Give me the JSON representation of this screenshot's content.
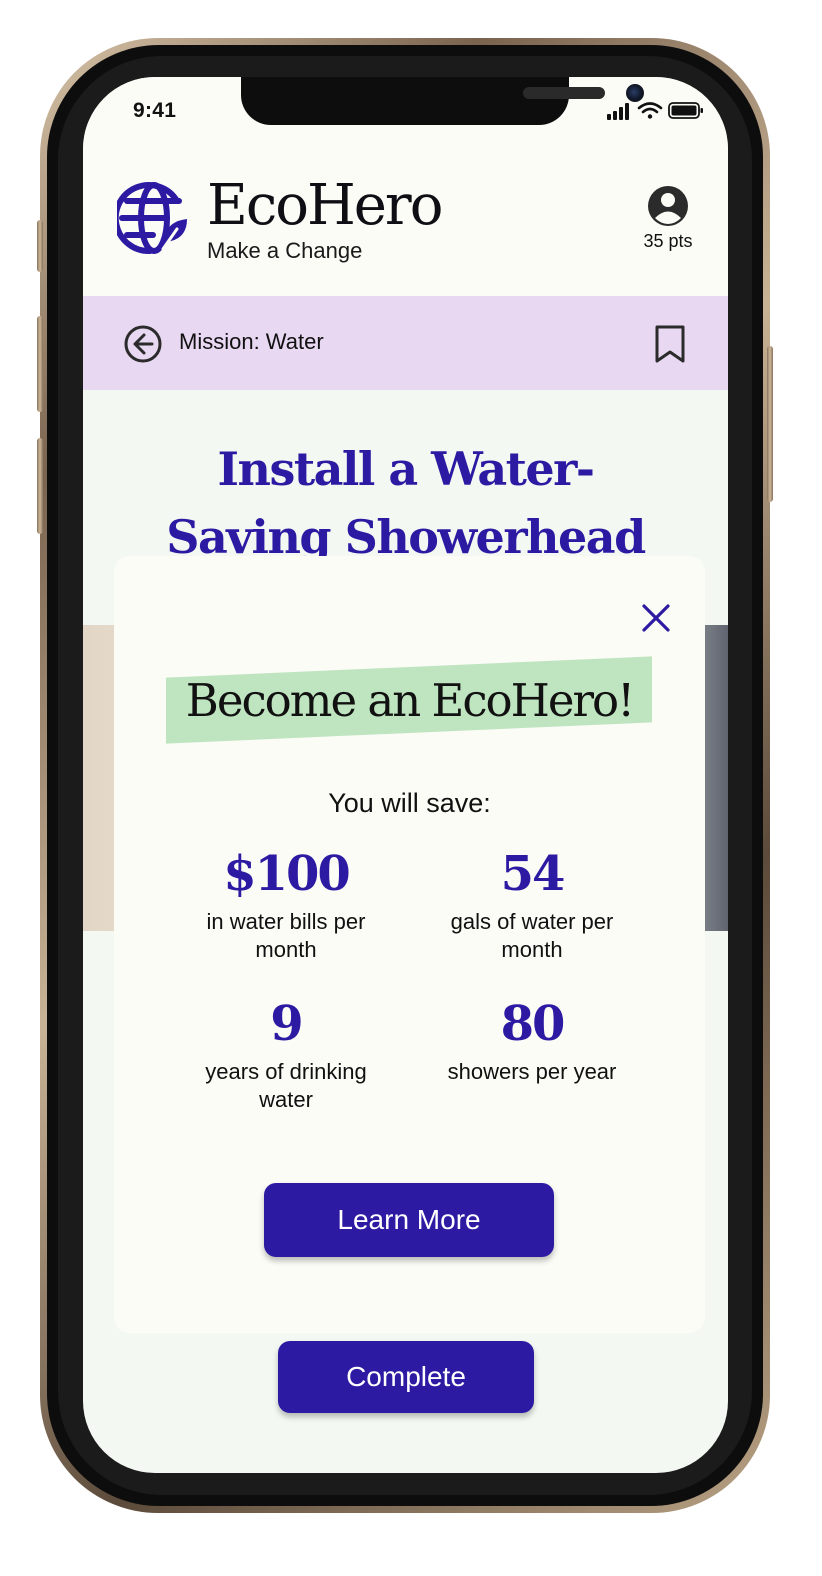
{
  "status_bar": {
    "time": "9:41",
    "icons": [
      "signal-icon",
      "wifi-icon",
      "battery-icon"
    ]
  },
  "header": {
    "brand_name": "EcoHero",
    "tagline": "Make a Change",
    "logo_icon": "globe-leaf-icon",
    "points": "35 pts",
    "profile_icon": "user-circle-icon"
  },
  "mission_bar": {
    "label": "Mission: Water",
    "back_icon": "back-arrow-circle-icon",
    "bookmark_icon": "bookmark-icon"
  },
  "page": {
    "title": "Install a Water-Saving Showerhead"
  },
  "modal": {
    "heading": "Become an EcoHero!",
    "subheading": "You will save:",
    "stats": [
      {
        "value": "$100",
        "description": "in water bills per month"
      },
      {
        "value": "54",
        "description": "gals of water per month"
      },
      {
        "value": "9",
        "description": "years of drinking water"
      },
      {
        "value": "80",
        "description": "showers per year"
      }
    ],
    "learn_more_label": "Learn More",
    "close_icon": "close-icon"
  },
  "footer": {
    "complete_label": "Complete"
  },
  "colors": {
    "brand_purple": "#2d1aa3",
    "mission_bar_bg": "#e8d8f2",
    "highlight_green": "#bfe4c0",
    "cream_bg": "#fbfcf6",
    "page_bg": "#f3f8f2"
  }
}
